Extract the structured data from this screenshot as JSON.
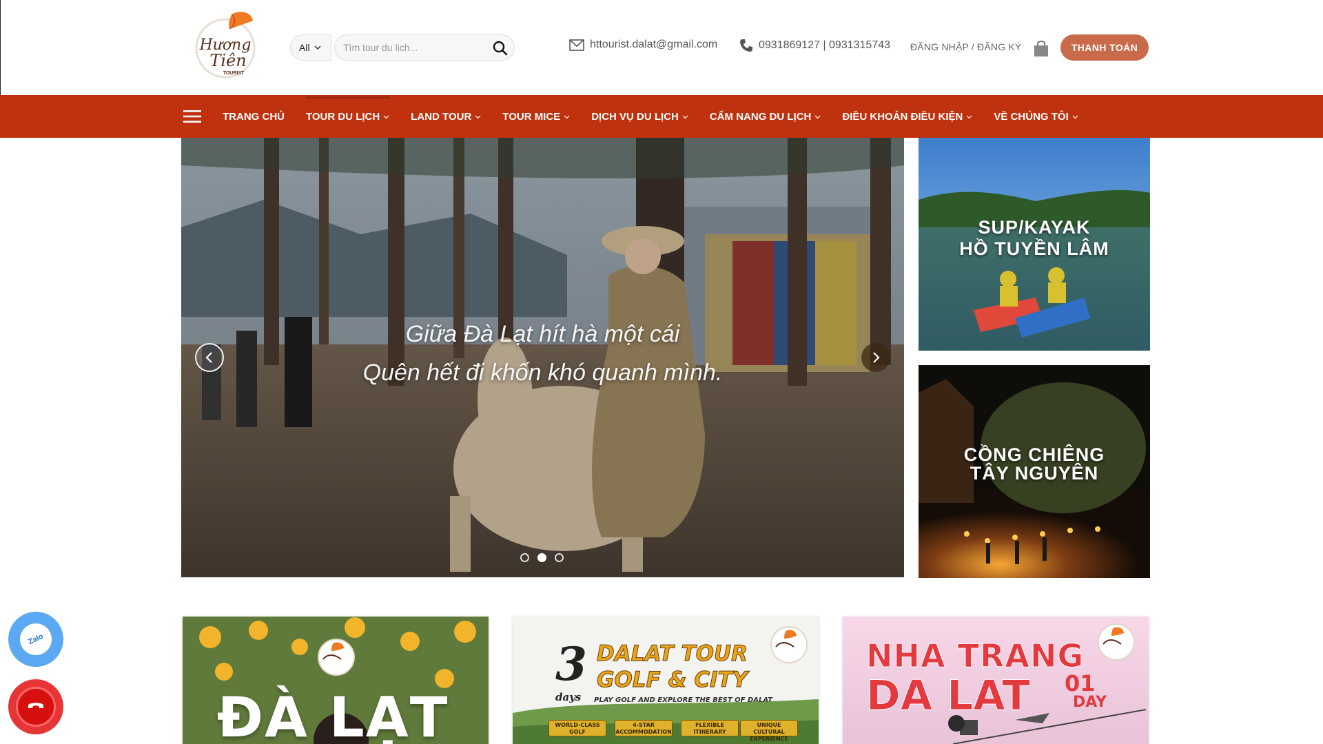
{
  "brand": {
    "logo_text_1": "Hương",
    "logo_text_2": "Tiên",
    "logo_text_3": "TOURIST"
  },
  "search": {
    "category": "All",
    "placeholder": "Tìm tour du lịch..."
  },
  "contact": {
    "email": "httourist.dalat@gmail.com",
    "phone": "0931869127 | 0931315743"
  },
  "account": {
    "login_label": "ĐĂNG NHẬP / ĐĂNG KÝ"
  },
  "checkout": {
    "label": "THANH TOÁN"
  },
  "nav": {
    "items": [
      {
        "label": "TRANG CHỦ"
      },
      {
        "label": "TOUR DU LỊCH"
      },
      {
        "label": "LAND TOUR"
      },
      {
        "label": "TOUR MICE"
      },
      {
        "label": "DỊCH VỤ DU LỊCH"
      },
      {
        "label": "CẨM NANG DU LỊCH"
      },
      {
        "label": "ĐIỀU KHOẢN ĐIỀU KIỆN"
      },
      {
        "label": "VỀ CHÚNG TÔI"
      }
    ]
  },
  "slider": {
    "line1": "Giữa Đà Lạt hít hà một cái",
    "line2": "Quên hết đi khốn khó quanh mình.",
    "slide_count": 3,
    "active_slide": 2
  },
  "side_banners": [
    {
      "line1": "SUP/KAYAK",
      "line2": "HỒ TUYỀN LÂM"
    },
    {
      "line1": "CỒNG CHIÊNG",
      "line2": "TÂY NGUYÊN"
    }
  ],
  "cards": [
    {
      "title": "ĐÀ LẠT"
    },
    {
      "num": "3",
      "days": "days",
      "title1": "DALAT TOUR",
      "title2": "GOLF & CITY",
      "subtitle": "PLAY GOLF AND EXPLORE THE BEST OF DALAT",
      "tags": [
        "WORLD-CLASS GOLF",
        "4-STAR ACCOMMODATION",
        "FLEXIBLE ITINERARY",
        "UNIQUE CULTURAL EXPERIENCE"
      ]
    },
    {
      "title1": "NHA TRANG",
      "title2": "DA LAT",
      "days1": "01",
      "days2": "DAY"
    }
  ],
  "floating": {
    "zalo_label": "Zalo"
  },
  "colors": {
    "nav_bg": "#c0310e",
    "checkout_bg": "#c96a4a",
    "zalo": "#5ba9f2",
    "call": "#e63535"
  }
}
